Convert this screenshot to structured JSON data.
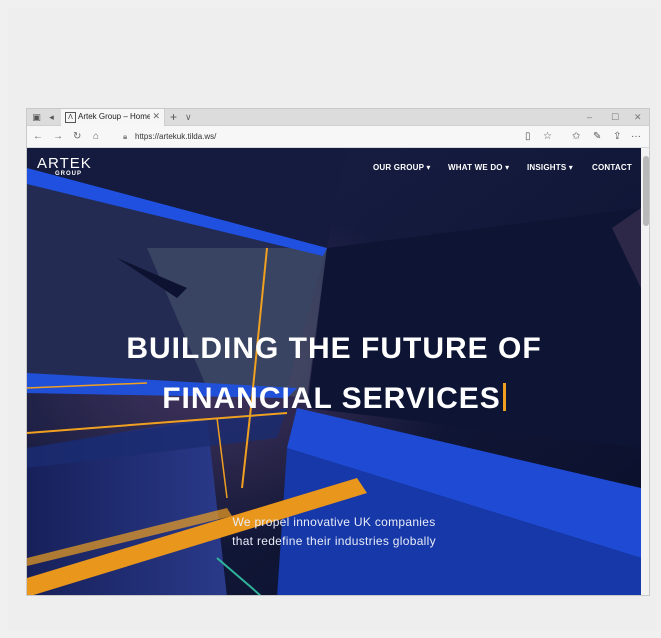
{
  "browser": {
    "tab_title": "Artek Group – Home Pa",
    "tab_close": "✕",
    "new_tab": "+",
    "tab_menu": "∨",
    "window_controls": {
      "minimize": "–",
      "maximize": "☐",
      "close": "✕"
    },
    "nav": {
      "back": "←",
      "forward": "→",
      "refresh": "↻",
      "home": "⌂"
    },
    "url": "https://artekuk.tilda.ws/",
    "toolbar": {
      "reading_view": "▯",
      "favorite": "☆",
      "favorites_hub": "✩",
      "pen": "✎",
      "share": "⇪",
      "more": "···"
    }
  },
  "site": {
    "logo": {
      "main": "ARTEK",
      "sub": "GROUP"
    },
    "nav": [
      "OUR GROUP ▾",
      "WHAT WE DO ▾",
      "INSIGHTS ▾",
      "CONTACT"
    ],
    "hero": {
      "title_line1": "BUILDING THE FUTURE OF",
      "title_line2": "FINANCIAL SERVICES",
      "subtitle_line1": "We propel innovative UK companies",
      "subtitle_line2": "that redefine their industries globally"
    },
    "colors": {
      "accent": "#f0a020",
      "blue": "#1f4fd8",
      "dark": "#0b1130"
    }
  }
}
